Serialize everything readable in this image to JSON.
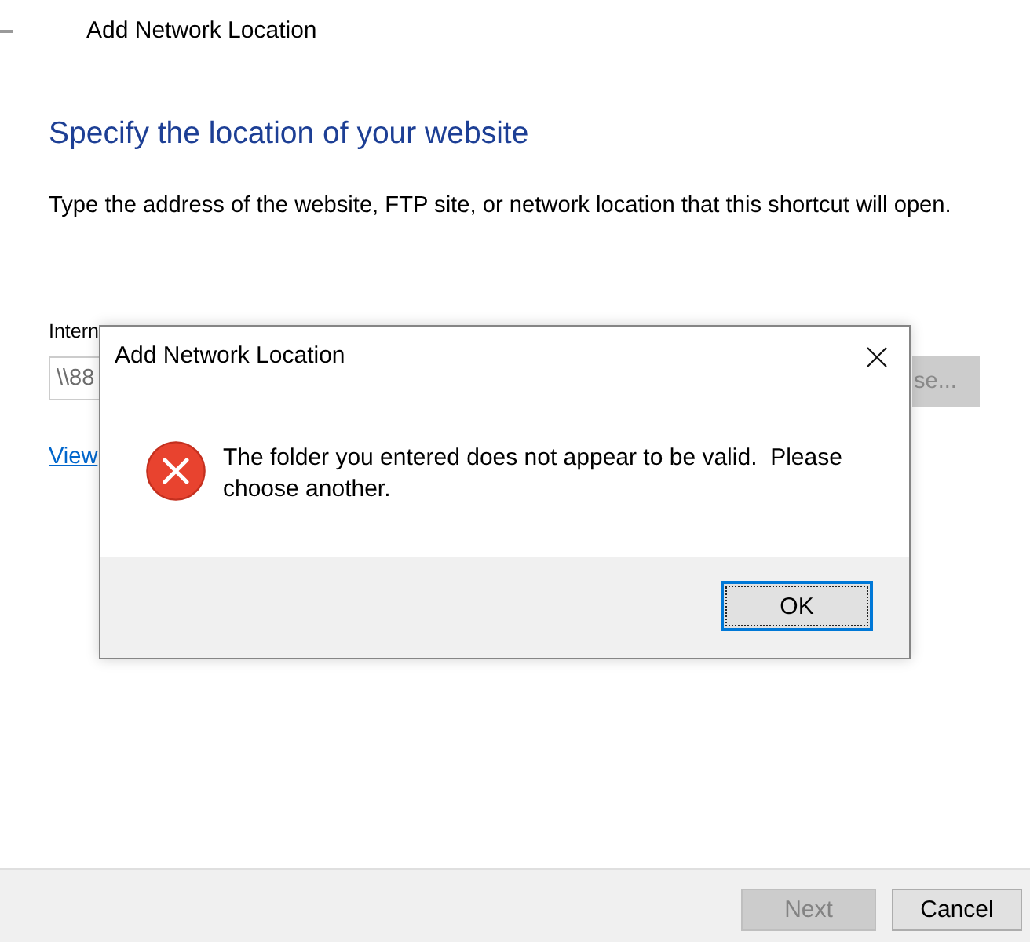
{
  "wizard": {
    "title": "Add Network Location",
    "heading": "Specify the location of your website",
    "description": "Type the address of the website, FTP site, or network location that this shortcut will open.",
    "address_label": "Intern",
    "address_field": {
      "value": "\\\\88",
      "disabled": true
    },
    "browse_button": {
      "label": "se...",
      "disabled": true
    },
    "link": "View",
    "buttons": [
      {
        "label": "Next",
        "disabled": true
      },
      {
        "label": "Cancel",
        "disabled": false
      }
    ]
  },
  "dialog": {
    "title": "Add Network Location",
    "kind": "error",
    "message": "The folder you entered does not appear to be valid.  Please choose another.",
    "buttons": [
      {
        "label": "OK",
        "default": true
      }
    ]
  }
}
